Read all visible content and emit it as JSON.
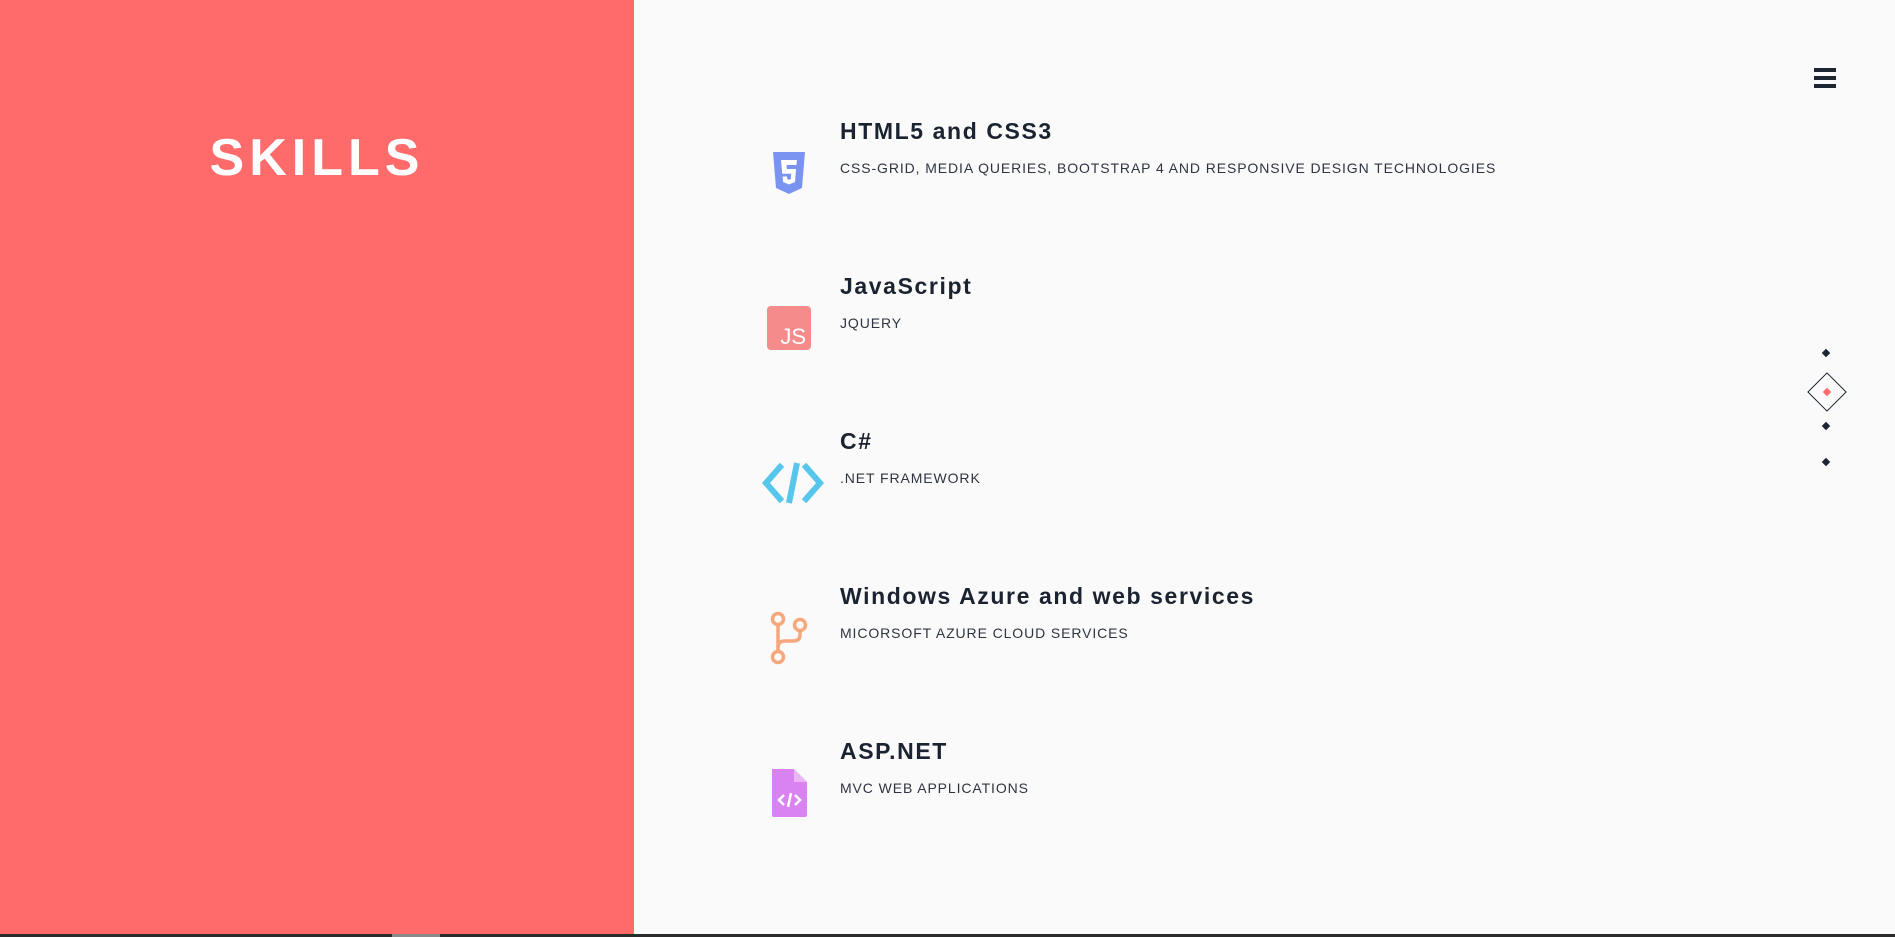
{
  "section": {
    "title": "SKILLS"
  },
  "colors": {
    "left_panel": "#ff6b6b",
    "background": "#fafafa",
    "heading": "#1b2230",
    "active_dot": "#ff6b6b"
  },
  "menu": {
    "icon": "hamburger-menu-icon"
  },
  "skills": [
    {
      "name": "HTML5 and CSS3",
      "description": "CSS-GRID, MEDIA QUERIES, BOOTSTRAP 4 AND RESPONSIVE DESIGN TECHNOLOGIES",
      "icon": "html5-icon",
      "icon_color": "#7b93f0"
    },
    {
      "name": "JavaScript",
      "description": "JQUERY",
      "icon": "javascript-icon",
      "icon_color": "#f58b8b"
    },
    {
      "name": "C#",
      "description": ".NET FRAMEWORK",
      "icon": "code-brackets-icon",
      "icon_color": "#56c6ec"
    },
    {
      "name": "Windows Azure and web services",
      "description": "MICORSOFT AZURE CLOUD SERVICES",
      "icon": "git-branch-icon",
      "icon_color": "#f7a77c"
    },
    {
      "name": "ASP.NET",
      "description": "MVC WEB APPLICATIONS",
      "icon": "code-file-icon",
      "icon_color": "#d883f0"
    }
  ],
  "dot_nav": {
    "count": 4,
    "active_index": 1
  }
}
